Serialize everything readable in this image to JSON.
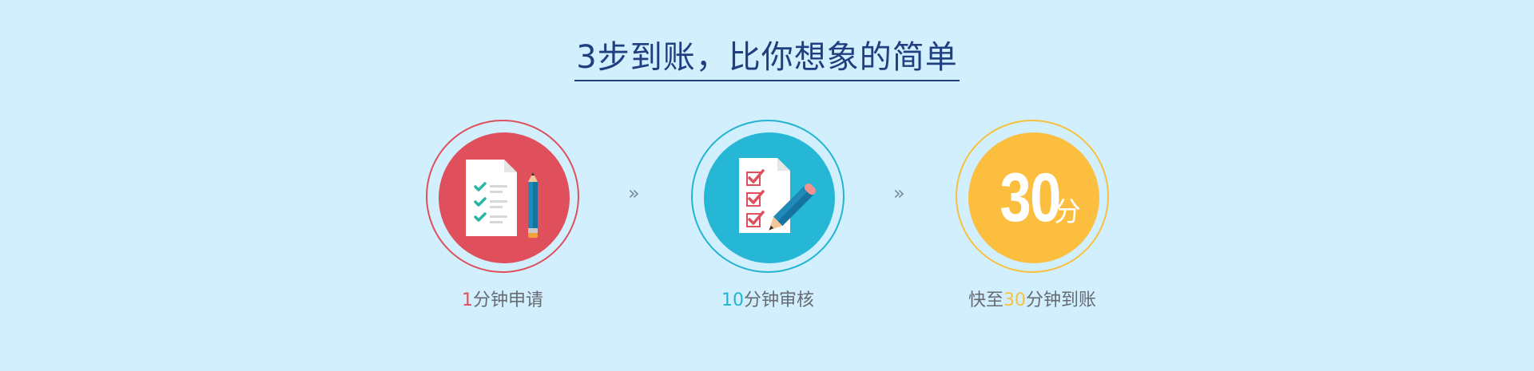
{
  "title": "3步到账，比你想象的简单",
  "arrow_glyph": "»",
  "steps": [
    {
      "icon": "checklist-pencil-icon",
      "caption_prefix": "",
      "caption_highlight": "1",
      "caption_suffix": "分钟申请",
      "color": "#e0505c"
    },
    {
      "icon": "review-checkmarks-pencil-icon",
      "caption_prefix": "",
      "caption_highlight": "10",
      "caption_suffix": "分钟审核",
      "color": "#26b6d6"
    },
    {
      "badge_number": "30",
      "badge_unit": "分",
      "caption_prefix": "快至",
      "caption_highlight": "30",
      "caption_suffix": "分钟到账",
      "color": "#fbbe3f"
    }
  ]
}
